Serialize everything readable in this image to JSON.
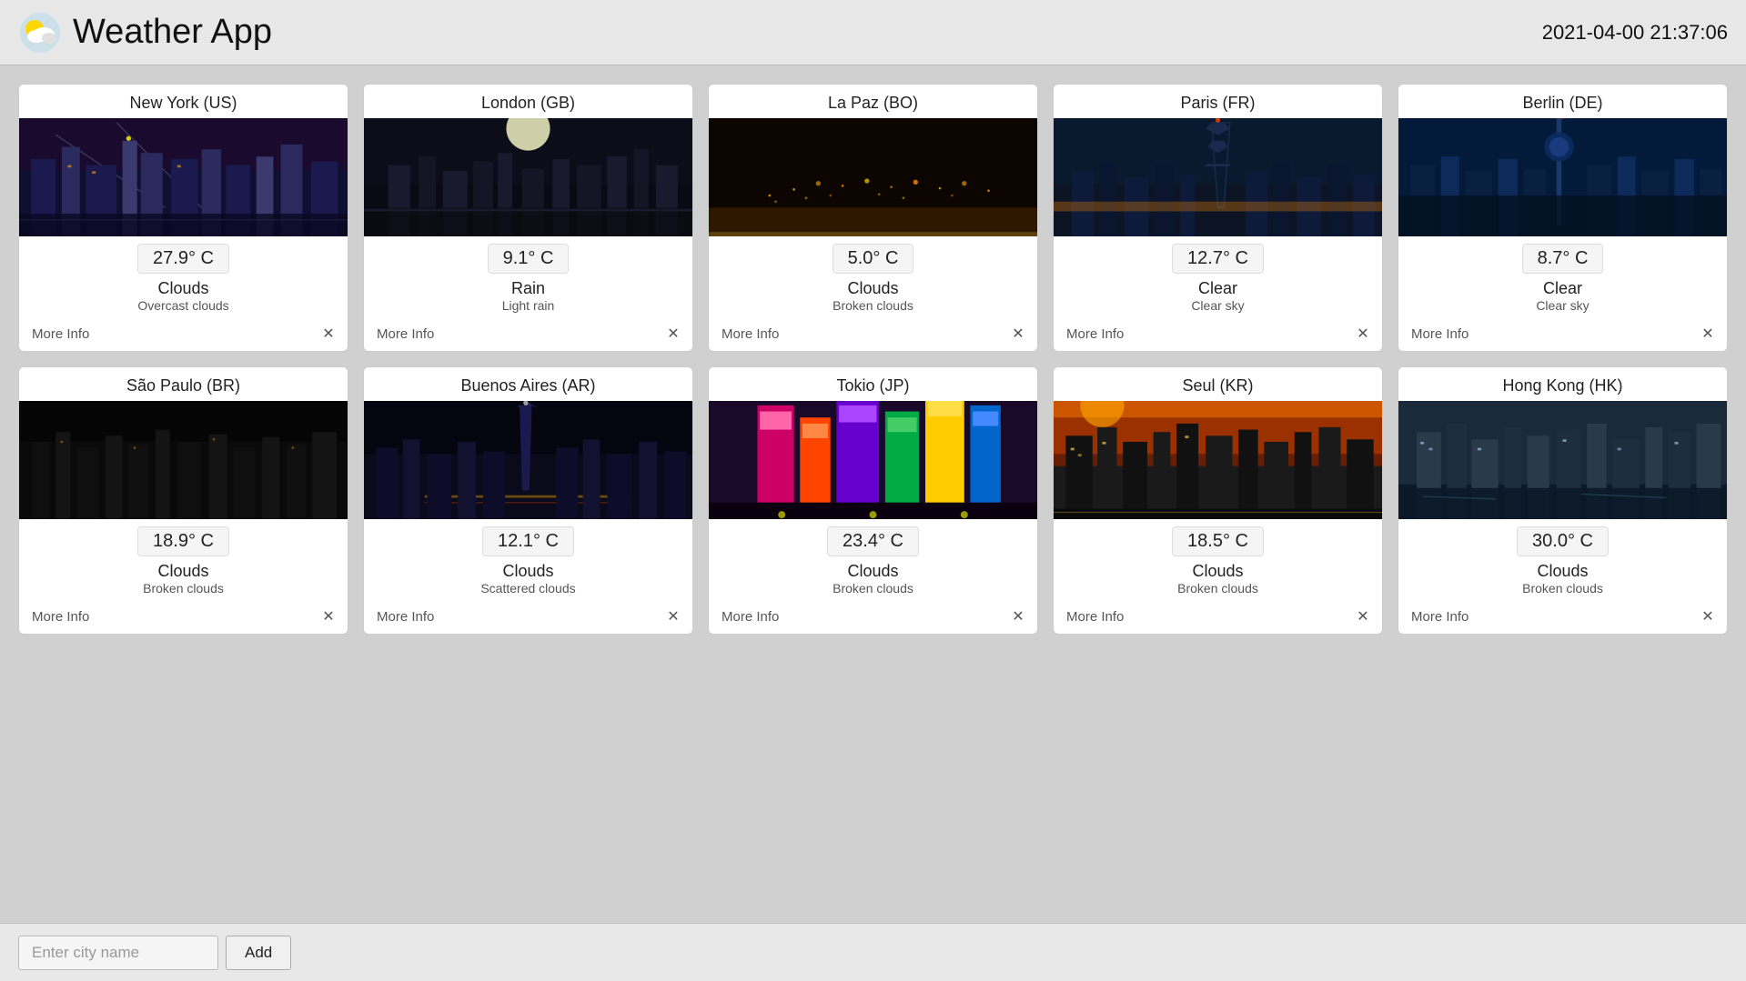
{
  "app": {
    "title": "Weather App",
    "datetime": "2021-04-00 21:37:06",
    "icon_label": "weather-app-icon"
  },
  "bottom_bar": {
    "input_placeholder": "Enter city name",
    "add_button_label": "Add"
  },
  "cities": [
    {
      "id": "new-york",
      "name": "New York (US)",
      "image_class": "img-newyork",
      "temp": "27.9° C",
      "weather_main": "Clouds",
      "weather_desc": "Overcast clouds",
      "more_info_label": "More Info"
    },
    {
      "id": "london",
      "name": "London (GB)",
      "image_class": "img-london",
      "temp": "9.1° C",
      "weather_main": "Rain",
      "weather_desc": "Light rain",
      "more_info_label": "More Info"
    },
    {
      "id": "la-paz",
      "name": "La Paz (BO)",
      "image_class": "img-lapaz",
      "temp": "5.0° C",
      "weather_main": "Clouds",
      "weather_desc": "Broken clouds",
      "more_info_label": "More Info"
    },
    {
      "id": "paris",
      "name": "Paris (FR)",
      "image_class": "img-paris",
      "temp": "12.7° C",
      "weather_main": "Clear",
      "weather_desc": "Clear sky",
      "more_info_label": "More Info"
    },
    {
      "id": "berlin",
      "name": "Berlin (DE)",
      "image_class": "img-berlin",
      "temp": "8.7° C",
      "weather_main": "Clear",
      "weather_desc": "Clear sky",
      "more_info_label": "More Info"
    },
    {
      "id": "sao-paulo",
      "name": "São Paulo (BR)",
      "image_class": "img-saopaulo",
      "temp": "18.9° C",
      "weather_main": "Clouds",
      "weather_desc": "Broken clouds",
      "more_info_label": "More Info"
    },
    {
      "id": "buenos-aires",
      "name": "Buenos Aires (AR)",
      "image_class": "img-buenosaires",
      "temp": "12.1° C",
      "weather_main": "Clouds",
      "weather_desc": "Scattered clouds",
      "more_info_label": "More Info"
    },
    {
      "id": "tokio",
      "name": "Tokio (JP)",
      "image_class": "img-tokio",
      "temp": "23.4° C",
      "weather_main": "Clouds",
      "weather_desc": "Broken clouds",
      "more_info_label": "More Info"
    },
    {
      "id": "seul",
      "name": "Seul (KR)",
      "image_class": "img-seul",
      "temp": "18.5° C",
      "weather_main": "Clouds",
      "weather_desc": "Broken clouds",
      "more_info_label": "More Info"
    },
    {
      "id": "hong-kong",
      "name": "Hong Kong (HK)",
      "image_class": "img-hongkong",
      "temp": "30.0° C",
      "weather_main": "Clouds",
      "weather_desc": "Broken clouds",
      "more_info_label": "More Info"
    }
  ]
}
